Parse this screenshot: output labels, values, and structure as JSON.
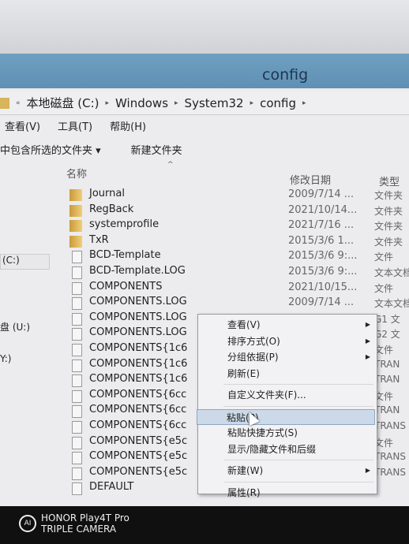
{
  "window": {
    "title": "config"
  },
  "breadcrumb": [
    "本地磁盘 (C:)",
    "Windows",
    "System32",
    "config"
  ],
  "menubar": [
    "查看(V)",
    "工具(T)",
    "帮助(H)"
  ],
  "toolbar": {
    "include_library": "中包含所选的文件夹 ▾",
    "new_folder": "新建文件夹"
  },
  "columns": {
    "name": "名称",
    "date": "修改日期",
    "type": "类型"
  },
  "sidebar": [
    "(C:)",
    "盘 (U:)",
    "Y:)"
  ],
  "files": [
    {
      "name": "Journal",
      "date": "2009/7/14 ...",
      "type": "文件夹",
      "kind": "folder"
    },
    {
      "name": "RegBack",
      "date": "2021/10/14...",
      "type": "文件夹",
      "kind": "folder"
    },
    {
      "name": "systemprofile",
      "date": "2021/7/16 ...",
      "type": "文件夹",
      "kind": "folder"
    },
    {
      "name": "TxR",
      "date": "2015/3/6 1...",
      "type": "文件夹",
      "kind": "folder"
    },
    {
      "name": "BCD-Template",
      "date": "2015/3/6 9:...",
      "type": "文件",
      "kind": "file"
    },
    {
      "name": "BCD-Template.LOG",
      "date": "2015/3/6 9:...",
      "type": "文本文档",
      "kind": "file"
    },
    {
      "name": "COMPONENTS",
      "date": "2021/10/15...",
      "type": "文件",
      "kind": "file"
    },
    {
      "name": "COMPONENTS.LOG",
      "date": "2009/7/14 ...",
      "type": "文本文档",
      "kind": "file"
    },
    {
      "name": "COMPONENTS.LOG",
      "date": "",
      "type": "G1 文",
      "kind": "file"
    },
    {
      "name": "COMPONENTS.LOG",
      "date": "",
      "type": "G2 文",
      "kind": "file"
    },
    {
      "name": "COMPONENTS{1c6",
      "date": "",
      "type": "文件",
      "kind": "file"
    },
    {
      "name": "COMPONENTS{1c6",
      "date": "",
      "type": "TRAN",
      "kind": "file"
    },
    {
      "name": "COMPONENTS{1c6",
      "date": "",
      "type": "TRAN",
      "kind": "file"
    },
    {
      "name": "COMPONENTS{6cc",
      "date": "",
      "type": "文件",
      "kind": "file"
    },
    {
      "name": "COMPONENTS{6cc",
      "date": "",
      "type": "TRAN",
      "kind": "file"
    },
    {
      "name": "COMPONENTS{6cc",
      "date": "",
      "type": "TRANS",
      "kind": "file"
    },
    {
      "name": "COMPONENTS{e5c",
      "date": "",
      "type": "文件",
      "kind": "file"
    },
    {
      "name": "COMPONENTS{e5c",
      "date": "",
      "type": "TRANS",
      "kind": "file"
    },
    {
      "name": "COMPONENTS{e5c",
      "date": "",
      "type": "TRANS",
      "kind": "file"
    },
    {
      "name": "DEFAULT",
      "date": "",
      "type": "",
      "kind": "file"
    }
  ],
  "context_menu": [
    {
      "label": "查看(V)",
      "submenu": true
    },
    {
      "label": "排序方式(O)",
      "submenu": true
    },
    {
      "label": "分组依据(P)",
      "submenu": true
    },
    {
      "label": "刷新(E)"
    },
    {
      "sep": true
    },
    {
      "label": "自定义文件夹(F)..."
    },
    {
      "sep": true
    },
    {
      "label": "粘贴(P)",
      "highlighted": true
    },
    {
      "label": "粘贴快捷方式(S)"
    },
    {
      "label": "显示/隐藏文件和后缀"
    },
    {
      "sep": true
    },
    {
      "label": "新建(W)",
      "submenu": true
    },
    {
      "sep": true
    },
    {
      "label": "属性(R)"
    }
  ],
  "watermark": {
    "line1": "HONOR Play4T Pro",
    "line2": "TRIPLE CAMERA",
    "logo": "AI"
  }
}
